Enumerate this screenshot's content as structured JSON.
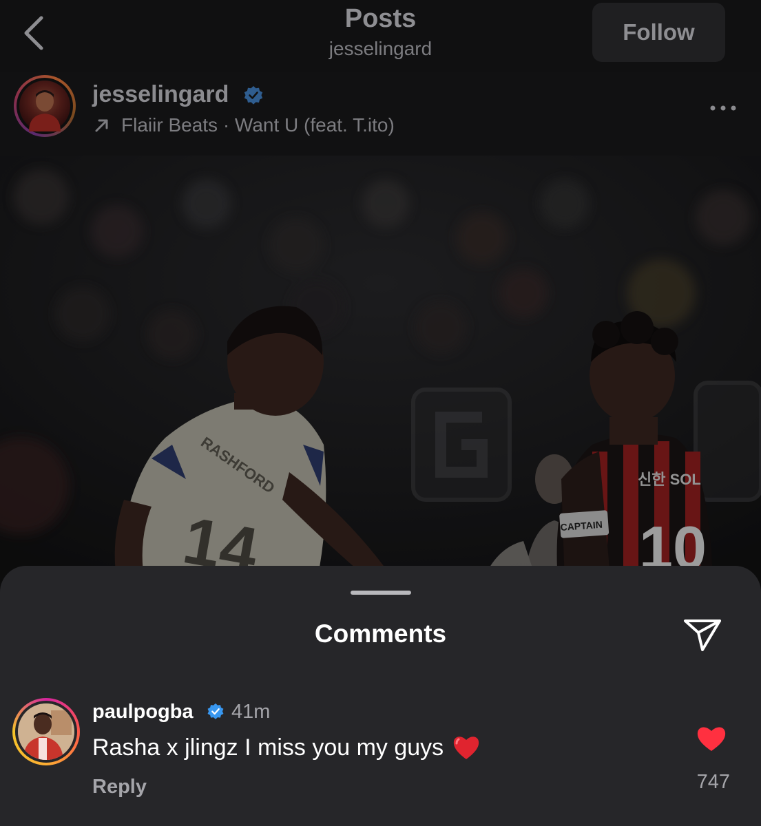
{
  "nav": {
    "title": "Posts",
    "subtitle": "jesselingard",
    "follow_label": "Follow"
  },
  "post": {
    "username": "jesselingard",
    "verified": true,
    "music": "Flaiir Beats · Want U (feat. T.ito)",
    "photo_icons": {
      "left_player_name": "RASHFORD",
      "left_player_number": "14",
      "right_player_number": "10",
      "right_sponsor": "신한 SOL",
      "captain_band": "CAPTAIN"
    }
  },
  "comments_sheet": {
    "title": "Comments",
    "comments": [
      {
        "username": "paulpogba",
        "verified": true,
        "time": "41m",
        "text": "Rasha x jlingz I miss you my guys",
        "emoji": "red-heart",
        "reply_label": "Reply",
        "likes": "747",
        "liked": true
      }
    ]
  },
  "colors": {
    "verified_blue": "#3897f0",
    "like_red": "#ff3040",
    "sheet_bg": "#262629"
  }
}
